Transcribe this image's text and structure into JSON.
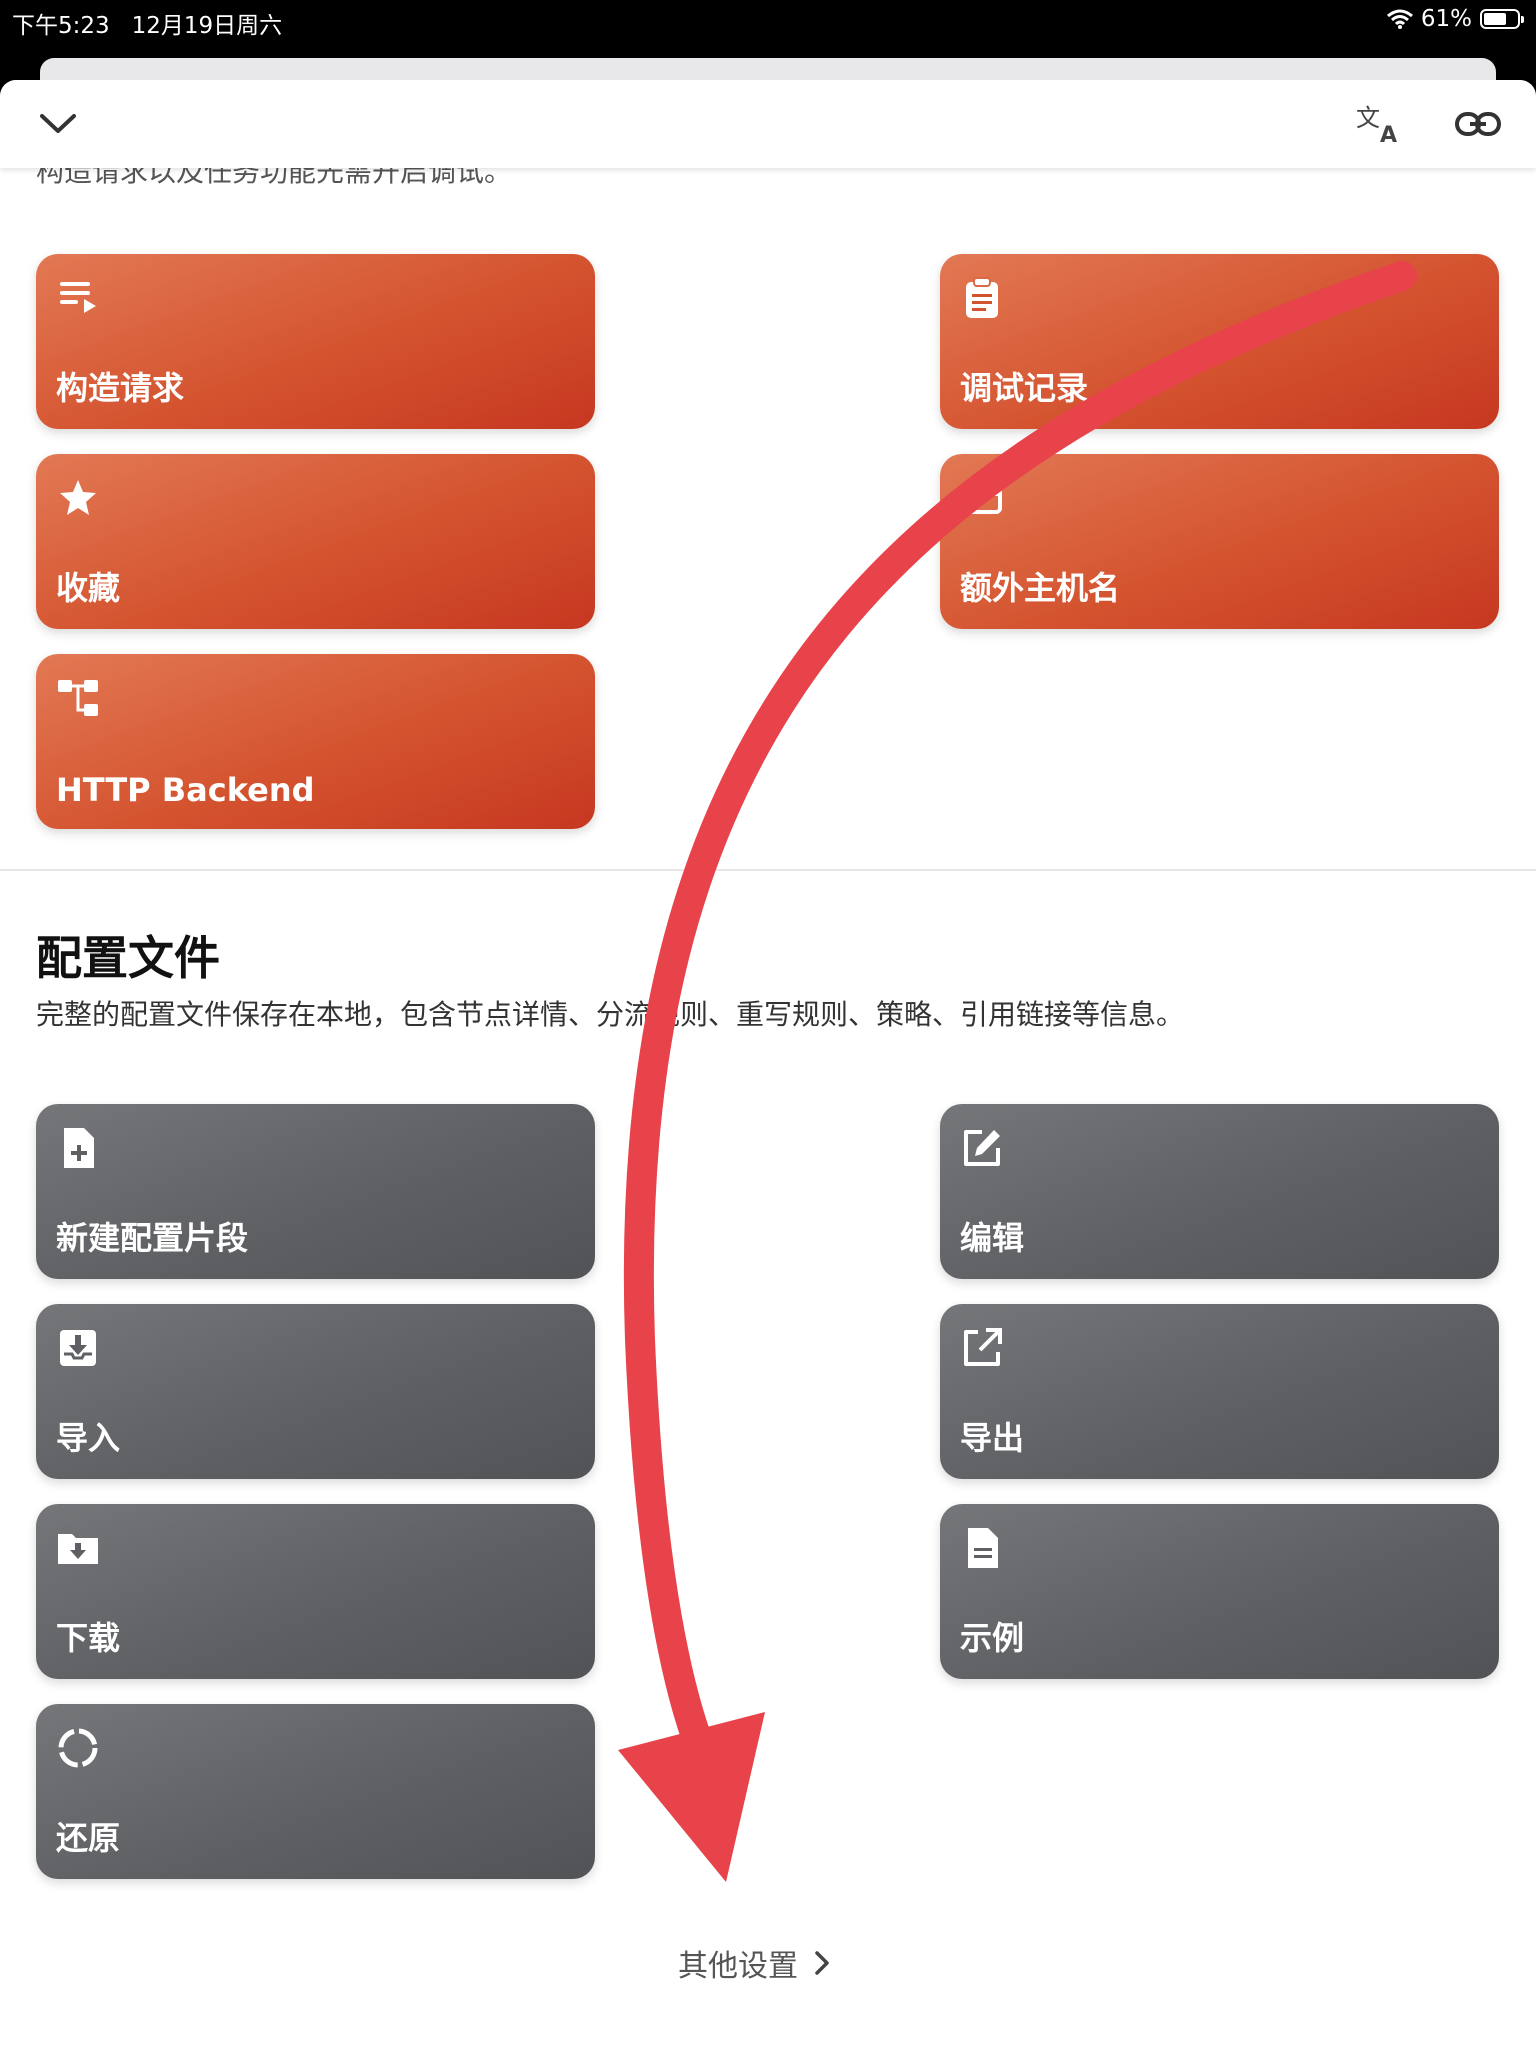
{
  "status": {
    "time_date": "下午5:23   12月19日周六",
    "battery": "61%"
  },
  "nav": {
    "collapse_icon": "chevron-down-icon",
    "translate_icon": "translate-icon",
    "link_icon": "link-icon"
  },
  "cut_text": "构造请求以及任务功能先需开启调试。",
  "debug_section": {
    "cards": [
      {
        "label": "构造请求",
        "icon": "list-play-icon"
      },
      {
        "label": "调试记录",
        "icon": "clipboard-icon"
      },
      {
        "label": "收藏",
        "icon": "star-icon"
      },
      {
        "label": "额外主机名",
        "icon": "host-icon"
      },
      {
        "label": "HTTP Backend",
        "icon": "tree-icon"
      }
    ]
  },
  "config_section": {
    "title": "配置文件",
    "description": "完整的配置文件保存在本地，包含节点详情、分流规则、重写规则、策略、引用链接等信息。",
    "cards": [
      {
        "label": "新建配置片段",
        "icon": "file-plus-icon"
      },
      {
        "label": "编辑",
        "icon": "edit-icon"
      },
      {
        "label": "导入",
        "icon": "import-icon"
      },
      {
        "label": "导出",
        "icon": "export-icon"
      },
      {
        "label": "下载",
        "icon": "folder-download-icon"
      },
      {
        "label": "示例",
        "icon": "document-icon"
      },
      {
        "label": "还原",
        "icon": "restore-icon"
      }
    ]
  },
  "footer": {
    "other_settings": "其他设置"
  },
  "colors": {
    "orange": "#d4532f",
    "gray": "#5e6064",
    "annotation_arrow": "#e8434b"
  }
}
